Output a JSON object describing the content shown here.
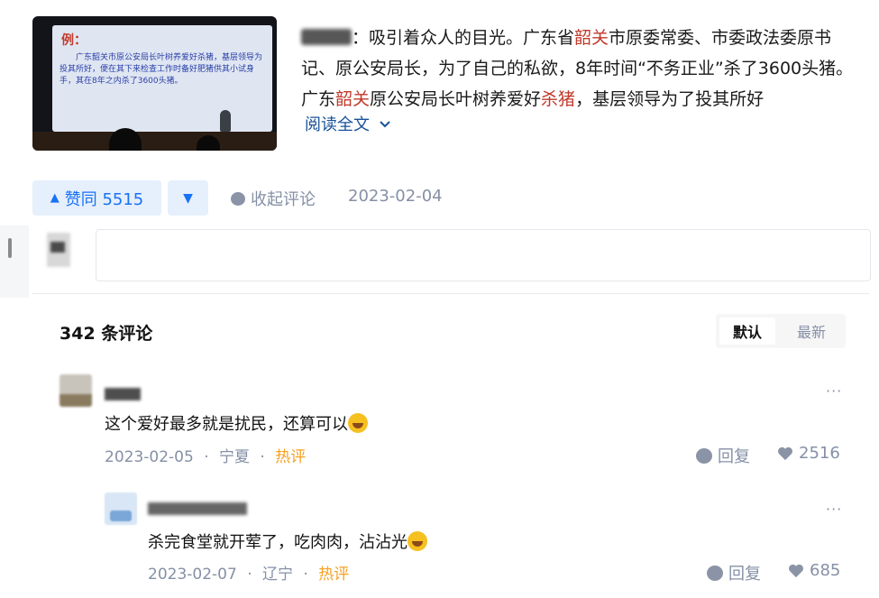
{
  "excerpt": {
    "author_suffix": "：",
    "p1": "吸引着众人的目光。广东省",
    "hl1": "韶关",
    "p2": "市原委常委、市委政法委原书记、原公安局长，为了自己的私欲，8年时间“不务正业”杀了3600头猪。广东",
    "hl2": "韶关",
    "p3": "原公安局长叶树养爱好",
    "hl3": "杀猪",
    "p4": "，基层领导为了投其所好",
    "read_more": "阅读全文",
    "slide_title": "例：",
    "slide_text": "广东韶关市原公安局长叶树养爱好杀猪，基层领导为投其所好，便在其下来检查工作时备好肥猪供其小试身手，其在8年之内杀了3600头猪。"
  },
  "actions": {
    "vote_label": "赞同 5515",
    "collapse_label": "收起评论",
    "date": "2023-02-04"
  },
  "comments_header": {
    "count_label": "342 条评论",
    "sort_default": "默认",
    "sort_latest": "最新"
  },
  "comments": [
    {
      "text": "这个爱好最多就是扰民，还算可以",
      "date": "2023-02-05",
      "location": "宁夏",
      "badge": "热评",
      "reply_label": "回复",
      "likes": "2516"
    },
    {
      "text": "杀完食堂就开荤了，吃肉肉，沾沾光",
      "date": "2023-02-07",
      "location": "辽宁",
      "badge": "热评",
      "reply_label": "回复",
      "likes": "685"
    }
  ],
  "separator": "·",
  "more_dots": "···",
  "icons": {
    "up_arrow": "▲",
    "down_arrow": "▼",
    "chevron": "chevron-down-icon",
    "comment": "comment-bubble-icon",
    "heart": "heart-icon"
  },
  "colors": {
    "accent": "#1772f6",
    "highlight": "#c0392b",
    "hot": "#f6a023",
    "muted": "#8590a6"
  }
}
